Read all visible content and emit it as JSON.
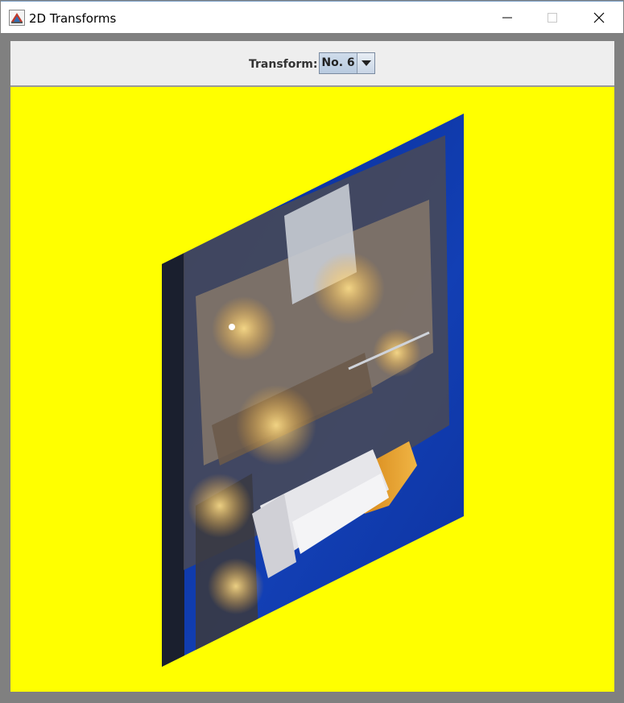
{
  "window": {
    "title": "2D Transforms",
    "icon": "java-app-icon",
    "controls": [
      "minimize-icon",
      "maximize-icon",
      "close-icon"
    ]
  },
  "toolbar": {
    "transform_label": "Transform:",
    "transform_selected": "No. 6"
  },
  "canvas": {
    "background": "#ffff00",
    "image": "space-shuttle-launch-pad-photo"
  }
}
